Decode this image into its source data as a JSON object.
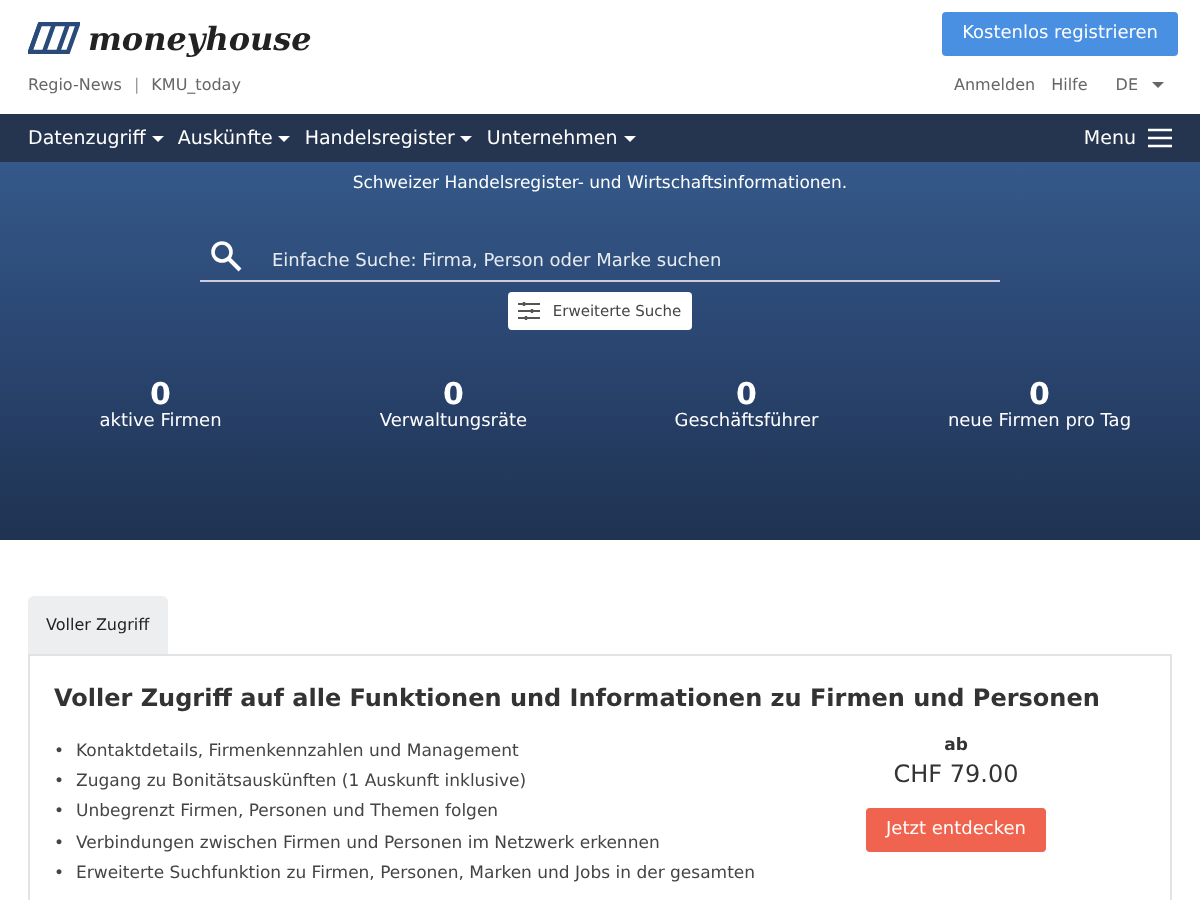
{
  "header": {
    "logo": "moneyhouse",
    "register_button": "Kostenlos registrieren",
    "links": [
      {
        "label": "Regio-News"
      },
      {
        "label": "KMU_today"
      }
    ],
    "separator": "|",
    "account_links": [
      {
        "label": "Anmelden"
      },
      {
        "label": "Hilfe"
      }
    ],
    "language": "DE"
  },
  "nav": {
    "items": [
      {
        "label": "Datenzugriff"
      },
      {
        "label": "Auskünfte"
      },
      {
        "label": "Handelsregister"
      },
      {
        "label": "Unternehmen"
      }
    ],
    "menu": "Menu"
  },
  "hero": {
    "tagline": "Schweizer Handelsregister- und Wirtschaftsinformationen.",
    "search": {
      "placeholder": "Einfache Suche: Firma, Person oder Marke suchen"
    },
    "advanced_button": "Erweiterte Suche",
    "stats": [
      {
        "value": "0",
        "label": "aktive Firmen"
      },
      {
        "value": "0",
        "label": "Verwaltungsräte"
      },
      {
        "value": "0",
        "label": "Geschäftsführer"
      },
      {
        "value": "0",
        "label": "neue Firmen pro Tag"
      }
    ]
  },
  "tabs": [
    {
      "label": "Voller Zugriff",
      "selected": true
    }
  ],
  "offer": {
    "title": "Voller Zugriff auf alle Funktionen und Informationen zu Firmen und Personen",
    "features": [
      "Kontaktdetails, Firmenkennzahlen und Management",
      "Zugang zu Bonitätsauskünften (1 Auskunft inklusive)",
      "Unbegrenzt Firmen, Personen und Themen folgen",
      "Verbindungen zwischen Firmen und Personen im Netzwerk erkennen",
      "Erweiterte Suchfunktion zu Firmen, Personen, Marken und Jobs in der gesamten"
    ],
    "bullet": "•",
    "price_prefix": "ab",
    "price": "CHF 79.00",
    "cta": "Jetzt entdecken"
  }
}
